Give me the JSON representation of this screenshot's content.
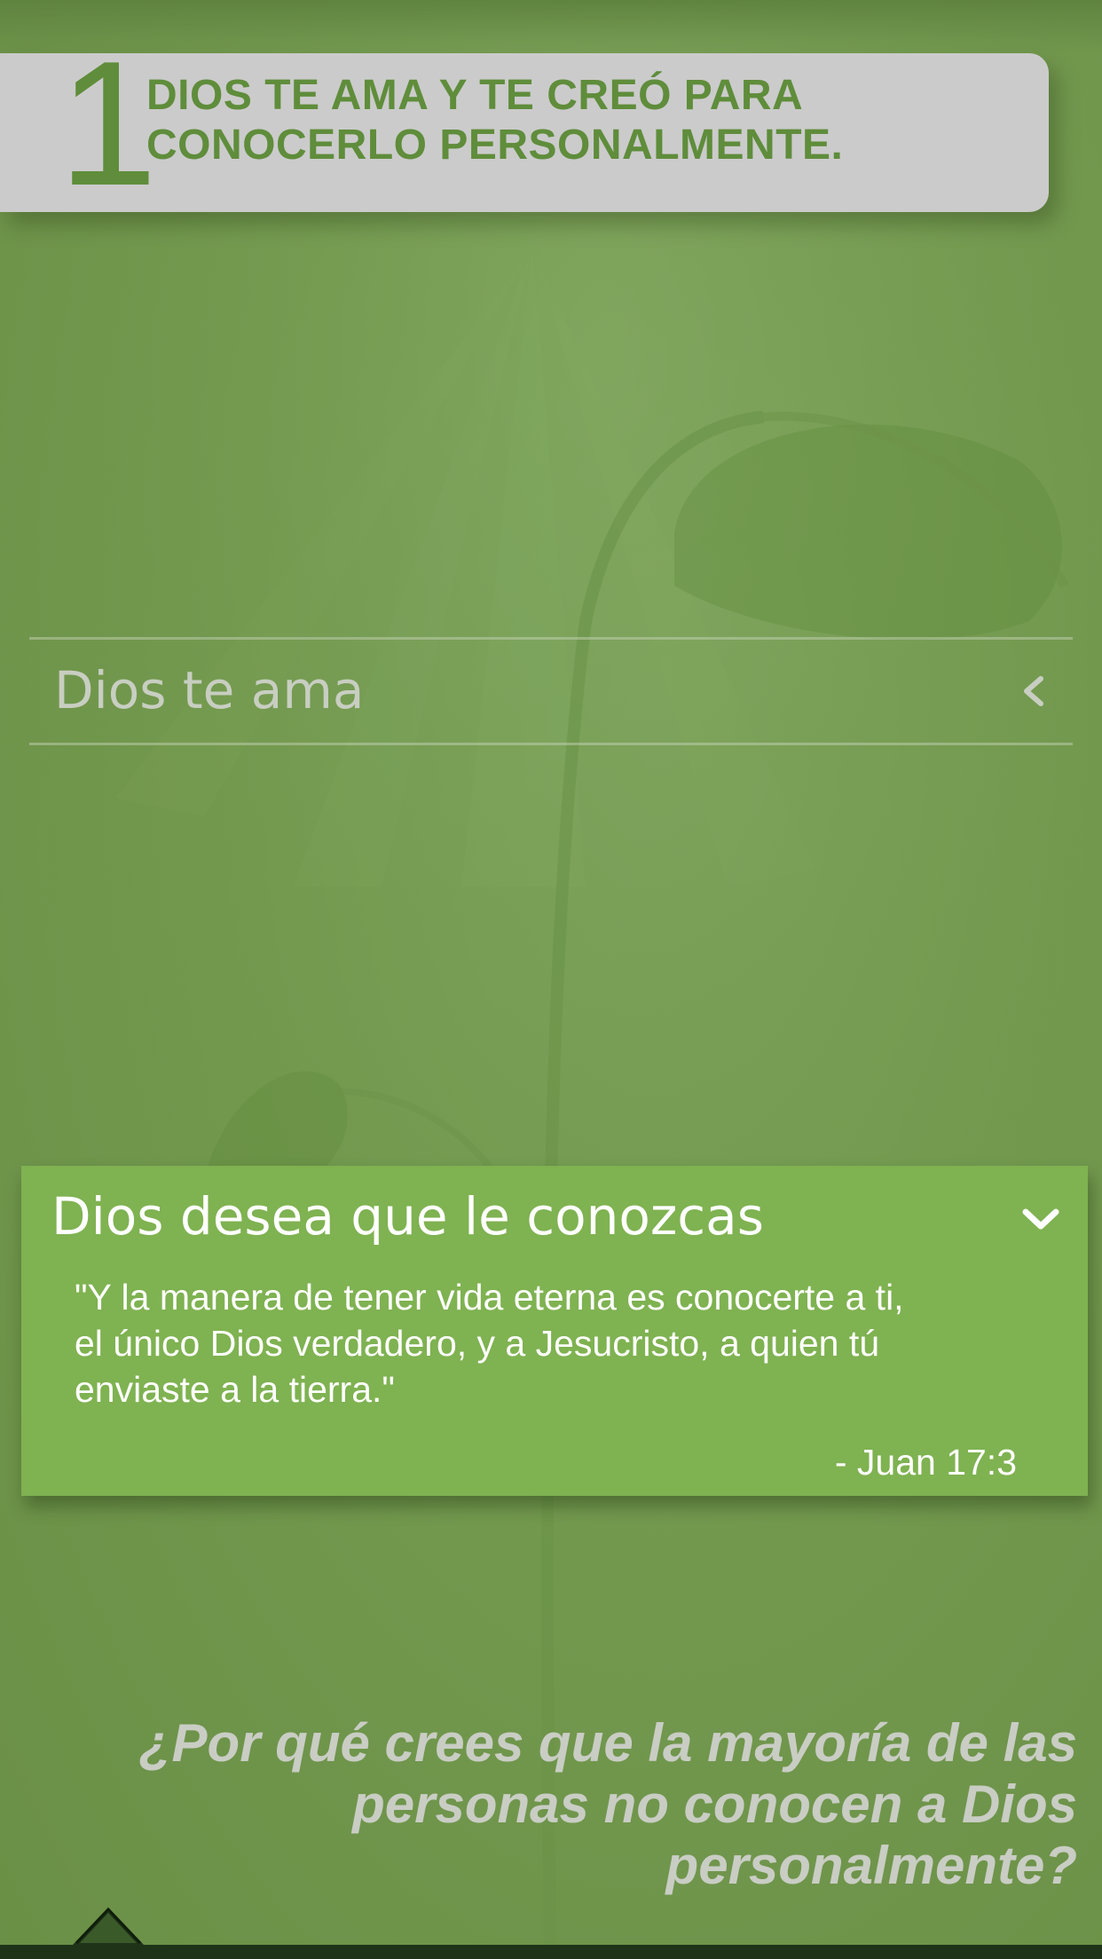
{
  "header": {
    "step_number": "1",
    "title_line1": "DIOS TE AMA Y TE CREÓ PARA",
    "title_line2": "CONOCERLO PERSONALMENTE."
  },
  "accordion_collapsed": {
    "label": "Dios te ama",
    "icon": "chevron-left-icon"
  },
  "accordion_expanded": {
    "title": "Dios desea que le conozcas",
    "icon": "chevron-down-icon",
    "verse_line1": "\"Y la manera de tener vida eterna es conocerte a ti,",
    "verse_line2": "el único Dios verdadero, y a Jesucristo, a quien tú",
    "verse_line3": "enviaste a la tierra.\"",
    "reference": "- Juan 17:3"
  },
  "question": {
    "line1": "¿Por qué crees que la mayoría de las",
    "line2": "personas no conocen a Dios",
    "line3": "personalmente?"
  },
  "bottom_nav": {
    "icon": "up-arrow-icon"
  },
  "colors": {
    "background": "#73994f",
    "banner": "#cbcbcb",
    "accent_green": "#5f8d3b",
    "card_green": "#7fb251",
    "muted_text": "#c8cec1"
  }
}
